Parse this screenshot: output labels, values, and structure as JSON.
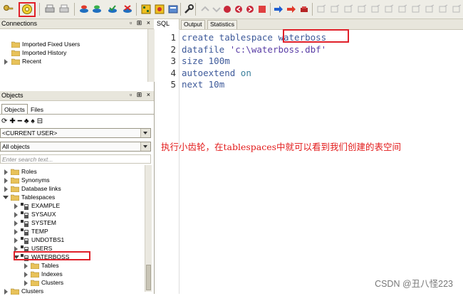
{
  "toolbar": {
    "icons": [
      "key-icon",
      "gear-icon",
      "printer-icon",
      "print-preview-icon",
      "db-connect-icon",
      "db-disconnect-icon",
      "db-commit-icon",
      "db-rollback-icon",
      "explain-plan-icon",
      "autotrace-icon",
      "compile-icon",
      "wrench-icon",
      "indent-icon",
      "unindent-icon",
      "bookmark-icon",
      "bookmark-prev-icon",
      "bookmark-next-icon",
      "run-icon",
      "step-over-icon",
      "stop-icon"
    ]
  },
  "connections": {
    "title": "Connections",
    "controls": "▫ ⊞ ×",
    "items": [
      {
        "label": "Imported Fixed Users"
      },
      {
        "label": "Imported History"
      },
      {
        "label": "Recent"
      }
    ]
  },
  "objects": {
    "title": "Objects",
    "controls": "▫ ⊞ ×",
    "tabs": [
      "Objects",
      "Files"
    ],
    "user_select": "<CURRENT USER>",
    "filter_select": "All objects",
    "search_placeholder": "Enter search text...",
    "tree": {
      "roles": "Roles",
      "synonyms": "Synonyms",
      "database_links": "Database links",
      "tablespaces": "Tablespaces",
      "tablespace_items": [
        "EXAMPLE",
        "SYSAUX",
        "SYSTEM",
        "TEMP",
        "UNDOTBS1",
        "USERS",
        "WATERBOSS"
      ],
      "waterboss_children": [
        "Tables",
        "Indexes",
        "Clusters"
      ],
      "clusters": "Clusters"
    }
  },
  "editor": {
    "tab_sql": "SQL",
    "tabs": [
      "Output",
      "Statistics"
    ],
    "lines": [
      {
        "n": "1",
        "kw": "create tablespace ",
        "rest": "waterboss",
        "kind": "ident"
      },
      {
        "n": "2",
        "kw": "datafile ",
        "rest": "'c:\\waterboss.dbf'",
        "kind": "str"
      },
      {
        "n": "3",
        "kw": "size ",
        "rest": "100m",
        "kind": "ident"
      },
      {
        "n": "4",
        "kw": "autoextend ",
        "rest": "on",
        "kind": "kw"
      },
      {
        "n": "5",
        "kw": "next ",
        "rest": "10m",
        "kind": "ident"
      }
    ]
  },
  "annotation": "执行小齿轮，在tablespaces中就可以看到我们创建的表空间",
  "watermark": "CSDN @丑八怪223",
  "colors": {
    "highlight": "#e0202a",
    "code": "#3e5a9a"
  }
}
